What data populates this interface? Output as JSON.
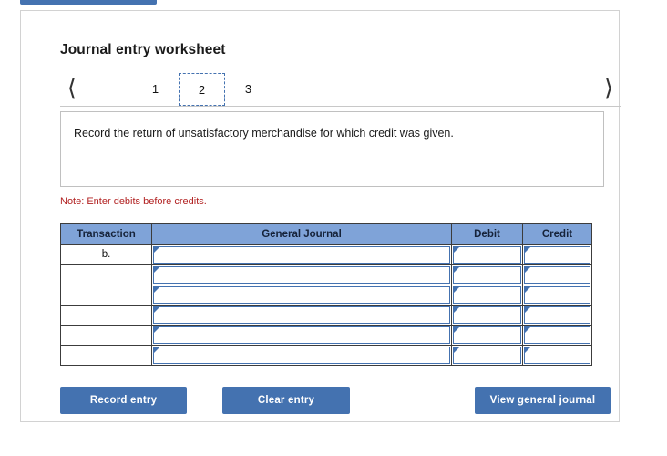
{
  "worksheet": {
    "title": "Journal entry worksheet",
    "pager": {
      "prev_icon": "chevron-left-icon",
      "next_icon": "chevron-right-icon",
      "pages": [
        "1",
        "2",
        "3"
      ],
      "active_page": "2"
    },
    "prompt": "Record the return of unsatisfactory merchandise for which credit was given.",
    "note": "Note: Enter debits before credits.",
    "table": {
      "headers": [
        "Transaction",
        "General Journal",
        "Debit",
        "Credit"
      ],
      "rows": [
        {
          "transaction": "b.",
          "general_journal": "",
          "debit": "",
          "credit": ""
        },
        {
          "transaction": "",
          "general_journal": "",
          "debit": "",
          "credit": ""
        },
        {
          "transaction": "",
          "general_journal": "",
          "debit": "",
          "credit": ""
        },
        {
          "transaction": "",
          "general_journal": "",
          "debit": "",
          "credit": ""
        },
        {
          "transaction": "",
          "general_journal": "",
          "debit": "",
          "credit": ""
        },
        {
          "transaction": "",
          "general_journal": "",
          "debit": "",
          "credit": ""
        }
      ]
    },
    "buttons": {
      "record": "Record entry",
      "clear": "Clear entry",
      "view": "View general journal"
    },
    "colors": {
      "accent": "#4472b0",
      "header_fill": "#7fa3d8",
      "note": "#b22222"
    }
  }
}
